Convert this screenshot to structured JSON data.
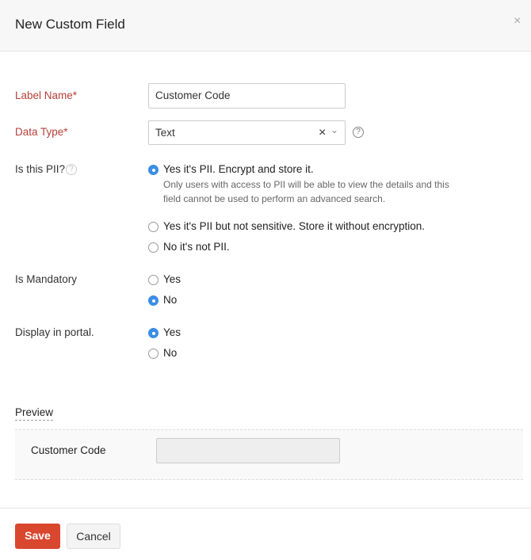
{
  "dialog": {
    "title": "New Custom Field",
    "close_icon": "×"
  },
  "form": {
    "label_name": {
      "label": "Label Name*",
      "value": "Customer Code"
    },
    "data_type": {
      "label": "Data Type*",
      "value": "Text",
      "clear": "×",
      "chevron": "⌄",
      "help": "?"
    },
    "pii": {
      "label": "Is this PII?",
      "help": "?",
      "options": [
        {
          "label": "Yes it's PII. Encrypt and store it.",
          "selected": true,
          "description": [
            "Only users with access to PII will be able to view the details and this",
            "field cannot be used to perform an advanced search."
          ]
        },
        {
          "label": "Yes it's PII but not sensitive. Store it without encryption.",
          "selected": false
        },
        {
          "label": "No it's not PII.",
          "selected": false
        }
      ]
    },
    "mandatory": {
      "label": "Is Mandatory",
      "options": [
        {
          "label": "Yes",
          "selected": false
        },
        {
          "label": "No",
          "selected": true
        }
      ]
    },
    "portal": {
      "label": "Display in portal.",
      "options": [
        {
          "label": "Yes",
          "selected": true
        },
        {
          "label": "No",
          "selected": false
        }
      ]
    }
  },
  "preview": {
    "heading": "Preview",
    "field_label": "Customer Code"
  },
  "footer": {
    "save": "Save",
    "cancel": "Cancel"
  },
  "colors": {
    "accent": "#3a8ee6",
    "save": "#d9472f",
    "required": "#b6403a"
  }
}
